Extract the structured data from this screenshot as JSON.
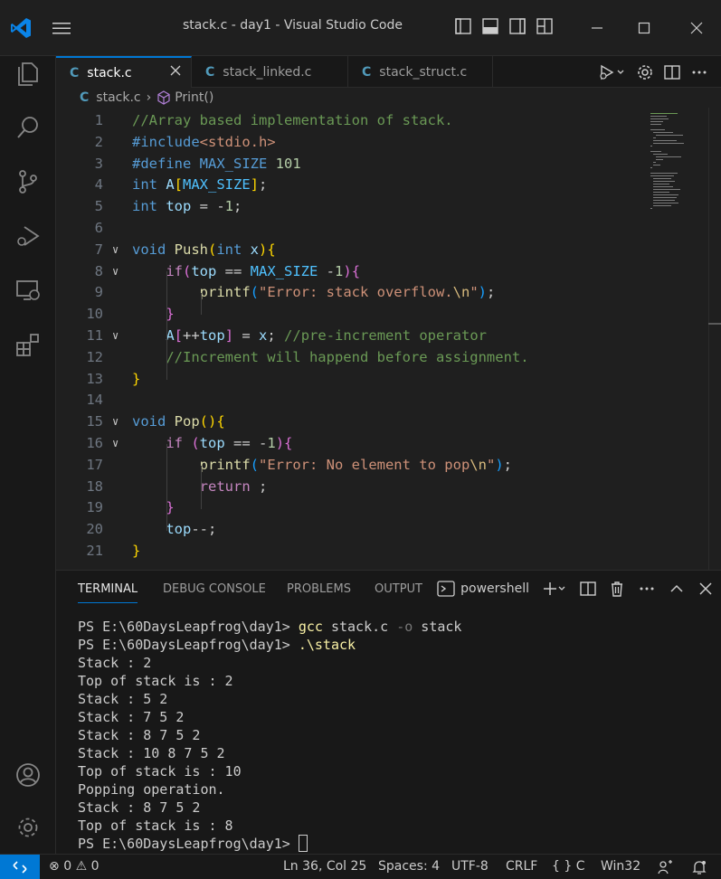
{
  "window": {
    "title": "stack.c - day1 - Visual Studio Code"
  },
  "tabs": [
    {
      "label": "stack.c",
      "active": true
    },
    {
      "label": "stack_linked.c",
      "active": false
    },
    {
      "label": "stack_struct.c",
      "active": false
    }
  ],
  "tab_icon_letter": "C",
  "breadcrumb": {
    "file": "stack.c",
    "symbol": "Print()"
  },
  "editor": {
    "lines": [
      {
        "n": "1",
        "tokens": [
          [
            "c",
            "//Array based implementation of stack."
          ]
        ]
      },
      {
        "n": "2",
        "tokens": [
          [
            "m",
            "#include"
          ],
          [
            "s",
            "<stdio.h>"
          ]
        ]
      },
      {
        "n": "3",
        "tokens": [
          [
            "m",
            "#define "
          ],
          [
            "k",
            "MAX_SIZE "
          ],
          [
            "num",
            "101"
          ]
        ]
      },
      {
        "n": "4",
        "tokens": [
          [
            "k",
            "int "
          ],
          [
            "v",
            "A"
          ],
          [
            "p1",
            "["
          ],
          [
            "const",
            "MAX_SIZE"
          ],
          [
            "p1",
            "]"
          ],
          [
            "d",
            ";"
          ]
        ]
      },
      {
        "n": "5",
        "tokens": [
          [
            "k",
            "int "
          ],
          [
            "v",
            "top"
          ],
          [
            "d",
            " = -"
          ],
          [
            "num",
            "1"
          ],
          [
            "d",
            ";"
          ]
        ]
      },
      {
        "n": "6",
        "tokens": []
      },
      {
        "n": "7",
        "fold": true,
        "tokens": [
          [
            "k",
            "void "
          ],
          [
            "f",
            "Push"
          ],
          [
            "p1",
            "("
          ],
          [
            "k",
            "int "
          ],
          [
            "v",
            "x"
          ],
          [
            "p1",
            ")"
          ],
          [
            "p1",
            "{"
          ]
        ]
      },
      {
        "n": "8",
        "fold": true,
        "tokens": [
          [
            "d",
            "    "
          ],
          [
            "ctl",
            "if"
          ],
          [
            "p2",
            "("
          ],
          [
            "v",
            "top"
          ],
          [
            "d",
            " == "
          ],
          [
            "const",
            "MAX_SIZE"
          ],
          [
            "d",
            " -"
          ],
          [
            "num",
            "1"
          ],
          [
            "p2",
            ")"
          ],
          [
            "p2",
            "{"
          ]
        ]
      },
      {
        "n": "9",
        "tokens": [
          [
            "d",
            "        "
          ],
          [
            "f",
            "printf"
          ],
          [
            "p3",
            "("
          ],
          [
            "s",
            "\"Error: stack overflow."
          ],
          [
            "e",
            "\\n"
          ],
          [
            "s",
            "\""
          ],
          [
            "p3",
            ")"
          ],
          [
            "d",
            ";"
          ]
        ]
      },
      {
        "n": "10",
        "tokens": [
          [
            "d",
            "    "
          ],
          [
            "p2",
            "}"
          ]
        ]
      },
      {
        "n": "11",
        "fold": true,
        "tokens": [
          [
            "d",
            "    "
          ],
          [
            "v",
            "A"
          ],
          [
            "p2",
            "["
          ],
          [
            "d",
            "++"
          ],
          [
            "v",
            "top"
          ],
          [
            "p2",
            "]"
          ],
          [
            "d",
            " = "
          ],
          [
            "v",
            "x"
          ],
          [
            "d",
            "; "
          ],
          [
            "c",
            "//pre-increment operator"
          ]
        ]
      },
      {
        "n": "12",
        "tokens": [
          [
            "d",
            "    "
          ],
          [
            "c",
            "//Increment will happend before assignment."
          ]
        ]
      },
      {
        "n": "13",
        "tokens": [
          [
            "p1",
            "}"
          ]
        ]
      },
      {
        "n": "14",
        "tokens": []
      },
      {
        "n": "15",
        "fold": true,
        "tokens": [
          [
            "k",
            "void "
          ],
          [
            "f",
            "Pop"
          ],
          [
            "p1",
            "("
          ],
          [
            "p1",
            ")"
          ],
          [
            "p1",
            "{"
          ]
        ]
      },
      {
        "n": "16",
        "fold": true,
        "tokens": [
          [
            "d",
            "    "
          ],
          [
            "ctl",
            "if "
          ],
          [
            "p2",
            "("
          ],
          [
            "v",
            "top"
          ],
          [
            "d",
            " == -"
          ],
          [
            "num",
            "1"
          ],
          [
            "p2",
            ")"
          ],
          [
            "p2",
            "{"
          ]
        ]
      },
      {
        "n": "17",
        "tokens": [
          [
            "d",
            "        "
          ],
          [
            "f",
            "printf"
          ],
          [
            "p3",
            "("
          ],
          [
            "s",
            "\"Error: No element to pop"
          ],
          [
            "e",
            "\\n"
          ],
          [
            "s",
            "\""
          ],
          [
            "p3",
            ")"
          ],
          [
            "d",
            ";"
          ]
        ]
      },
      {
        "n": "18",
        "tokens": [
          [
            "d",
            "        "
          ],
          [
            "ctl",
            "return"
          ],
          [
            "d",
            " ;"
          ]
        ]
      },
      {
        "n": "19",
        "tokens": [
          [
            "d",
            "    "
          ],
          [
            "p2",
            "}"
          ]
        ]
      },
      {
        "n": "20",
        "tokens": [
          [
            "d",
            "    "
          ],
          [
            "v",
            "top"
          ],
          [
            "d",
            "--;"
          ]
        ]
      },
      {
        "n": "21",
        "tokens": [
          [
            "p1",
            "}"
          ]
        ]
      }
    ]
  },
  "panel": {
    "tabs": [
      "TERMINAL",
      "DEBUG CONSOLE",
      "PROBLEMS",
      "OUTPUT"
    ],
    "terminal_name": "powershell",
    "lines": [
      {
        "prompt": "PS E:\\60DaysLeapfrog\\day1> ",
        "cmd": "gcc",
        "rest": " stack.c ",
        "flag": "-o",
        "tail": " stack"
      },
      {
        "prompt": "PS E:\\60DaysLeapfrog\\day1> ",
        "cmd": ".\\stack",
        "rest": "",
        "flag": "",
        "tail": ""
      },
      {
        "text": "Stack : 2"
      },
      {
        "text": "Top of stack is : 2"
      },
      {
        "text": "Stack : 5 2"
      },
      {
        "text": "Stack : 7 5 2"
      },
      {
        "text": "Stack : 8 7 5 2"
      },
      {
        "text": "Stack : 10 8 7 5 2"
      },
      {
        "text": "Top of stack is : 10"
      },
      {
        "text": "Popping operation."
      },
      {
        "text": "Stack : 8 7 5 2"
      },
      {
        "text": "Top of stack is : 8"
      },
      {
        "prompt": "PS E:\\60DaysLeapfrog\\day1> ",
        "cursor": true
      }
    ]
  },
  "statusbar": {
    "errors": "0",
    "warnings": "0",
    "position": "Ln 36, Col 25",
    "spaces": "Spaces: 4",
    "encoding": "UTF-8",
    "eol": "CRLF",
    "language": "C",
    "language_icon": "{ }",
    "platform": "Win32"
  },
  "colors": {
    "accent": "#0078d4",
    "c_icon": "#519aba"
  }
}
